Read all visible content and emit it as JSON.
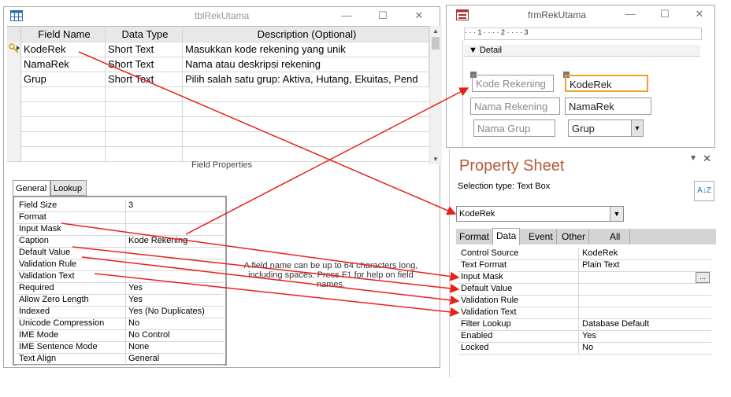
{
  "table_window": {
    "title": "tblRekUtama",
    "minimize": "—",
    "maximize": "☐",
    "close": "✕",
    "headers": [
      "Field Name",
      "Data Type",
      "Description (Optional)"
    ],
    "rows": [
      {
        "name": "KodeRek",
        "type": "Short Text",
        "desc": "Masukkan kode rekening yang unik"
      },
      {
        "name": "NamaRek",
        "type": "Short Text",
        "desc": "Nama atau deskripsi rekening"
      },
      {
        "name": "Grup",
        "type": "Short Text",
        "desc": "Pilih salah satu grup: Aktiva, Hutang, Ekuitas, Pend"
      }
    ],
    "field_properties_label": "Field Properties",
    "tabs": [
      "General",
      "Lookup"
    ],
    "properties": [
      {
        "k": "Field Size",
        "v": "3"
      },
      {
        "k": "Format",
        "v": ""
      },
      {
        "k": "Input Mask",
        "v": ""
      },
      {
        "k": "Caption",
        "v": "Kode Rekening"
      },
      {
        "k": "Default Value",
        "v": ""
      },
      {
        "k": "Validation Rule",
        "v": ""
      },
      {
        "k": "Validation Text",
        "v": ""
      },
      {
        "k": "Required",
        "v": "Yes"
      },
      {
        "k": "Allow Zero Length",
        "v": "Yes"
      },
      {
        "k": "Indexed",
        "v": "Yes (No Duplicates)"
      },
      {
        "k": "Unicode Compression",
        "v": "No"
      },
      {
        "k": "IME Mode",
        "v": "No Control"
      },
      {
        "k": "IME Sentence Mode",
        "v": "None"
      },
      {
        "k": "Text Align",
        "v": "General"
      }
    ],
    "help_text": "A field name can be up to 64 characters long, including spaces. Press F1 for help on field names."
  },
  "form_window": {
    "title": "frmRekUtama",
    "ruler_text": "·  ·  ·  1  ·  ·  ·  ·  2  ·  ·  ·  ·  3",
    "detail_label": "Detail",
    "labels": [
      "Kode Rekening",
      "Nama Rekening",
      "Nama Grup"
    ],
    "textboxes": [
      "KodeRek",
      "NamaRek",
      "Grup"
    ]
  },
  "property_sheet": {
    "title": "Property Sheet",
    "selection_type": "Selection type:  Text Box",
    "selected_control": "KodeRek",
    "tabs": [
      "Format",
      "Data",
      "Event",
      "Other",
      "All"
    ],
    "active_tab": "Data",
    "properties": [
      {
        "k": "Control Source",
        "v": "KodeRek"
      },
      {
        "k": "Text Format",
        "v": "Plain Text"
      },
      {
        "k": "Input Mask",
        "v": ""
      },
      {
        "k": "Default Value",
        "v": ""
      },
      {
        "k": "Validation Rule",
        "v": ""
      },
      {
        "k": "Validation Text",
        "v": ""
      },
      {
        "k": "Filter Lookup",
        "v": "Database Default"
      },
      {
        "k": "Enabled",
        "v": "Yes"
      },
      {
        "k": "Locked",
        "v": "No"
      }
    ],
    "dots_button": "...",
    "sort_icon": "A↓Z"
  },
  "colors": {
    "arrow": "#e8201c",
    "ps_title": "#b45a3a",
    "selection": "#f0a030"
  }
}
